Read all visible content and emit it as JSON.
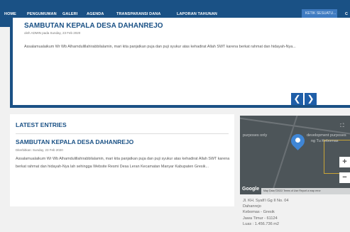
{
  "nav": {
    "items": [
      "HOME",
      "PENGUMUMAN",
      "GALERI",
      "AGENDA",
      "TRANSPARANSI DANA",
      "LAPORAN TAHUNAN"
    ],
    "search_placeholder": "KETIK SESUATU...",
    "search_button": "C"
  },
  "slider": {
    "title": "SAMBUTAN KEPALA DESA DAHANREJO",
    "meta": "oleh ADMIN pada Sunday, 23 Feb 2020",
    "excerpt": "Assalamualaikum Wr Wb Alhamdulillahirabbilalamin, mari kita panjatkan puja dan puji syukur atas kehadirat Allah SWT karena berkat rahmat dan hidayah-Nya...",
    "prev": "❮",
    "next": "❯"
  },
  "latest": {
    "heading": "LATEST ENTRIES",
    "entry_title": "SAMBUTAN KEPALA DESA DAHANREJO",
    "entry_meta": "Diterbitkan: Sunday, 23 Feb 2020",
    "entry_text": "Assalamualaikum Wr Wb Alhamdulillahirabbilalamin, mari kita panjatkan puja dan puji syukur atas kehadirat Allah SWT karena berkat rahmat dan hidayah-Nya lah sehingga Website Resmi Desa Leran Kecamatan Manyar Kabupaten Gresik..."
  },
  "map": {
    "label_a": "purposes only",
    "label_b": "development purposes",
    "label_c": "ng Tu Kebomas",
    "zoom_in": "+",
    "zoom_out": "−",
    "fullscreen": "⛶",
    "google": "Google",
    "footer": "Map Data ©2022   Terms of Use   Report a map error"
  },
  "address": {
    "lines": [
      "Jl. KH. Syafi'i Gg II No. 04",
      "Dahanrejo",
      "Kebomas - Gresik",
      "Jawa Timur - 61124",
      "Luas : 1.456.736 m2"
    ]
  },
  "colors": {
    "nav_bg": "#1a5185",
    "accent": "#1a5185",
    "slider_buttons": "#1f5ea8"
  }
}
